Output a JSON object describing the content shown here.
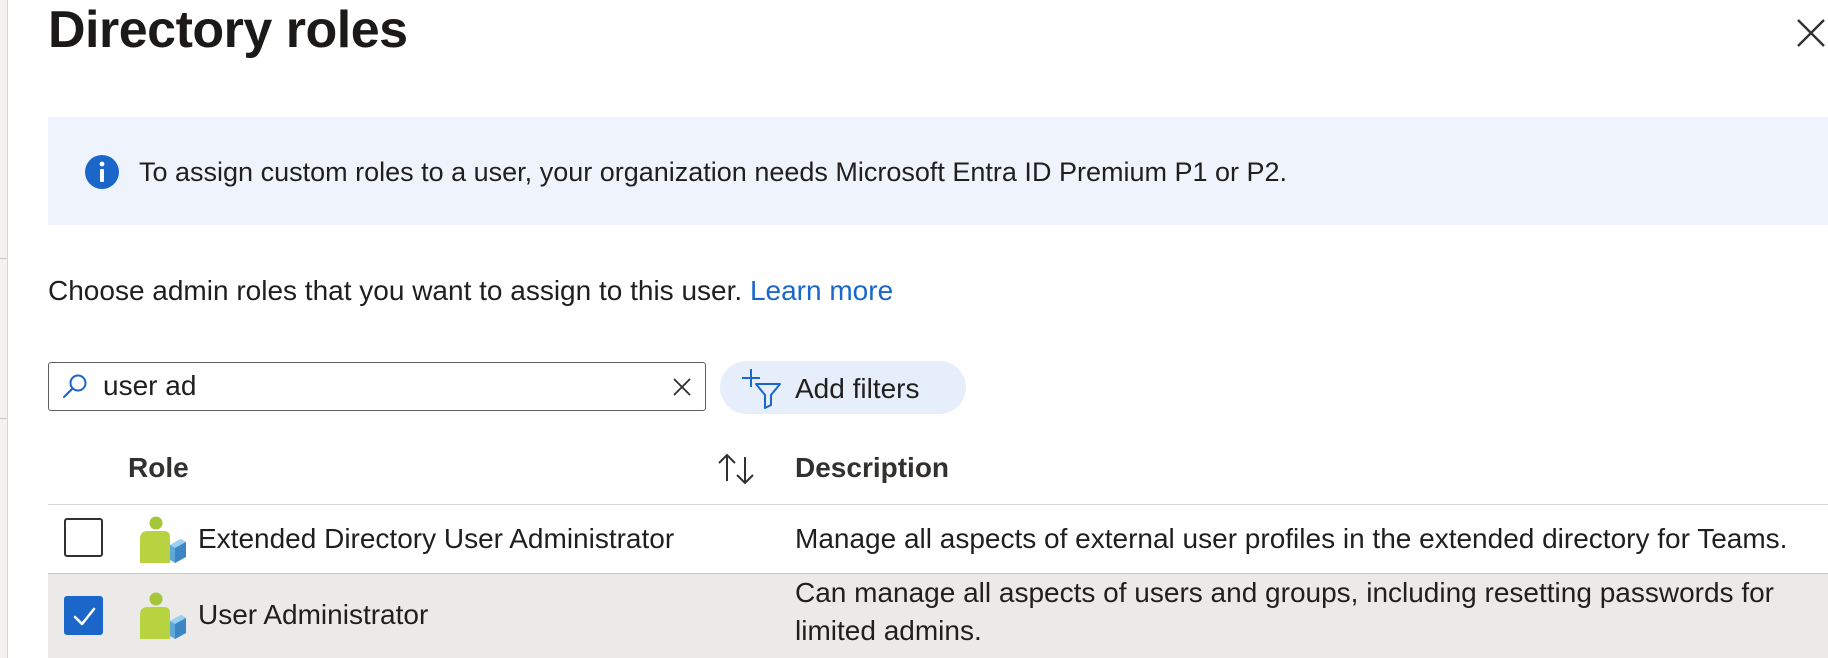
{
  "panel": {
    "title": "Directory roles",
    "close_icon": "close-icon"
  },
  "info_banner": {
    "icon": "info-icon",
    "text": "To assign custom roles to a user, your organization needs Microsoft Entra ID Premium P1 or P2.",
    "icon_color": "#1a66c9",
    "background": "#eff4fc"
  },
  "intro": {
    "text": "Choose admin roles that you want to assign to this user.",
    "link_label": "Learn more"
  },
  "search": {
    "value": "user ad",
    "icon": "search-icon",
    "clear_icon": "close-icon"
  },
  "filter_button": {
    "label": "Add filters",
    "icon": "add-filter-icon"
  },
  "table": {
    "columns": {
      "role": "Role",
      "description": "Description",
      "sort_icon": "sort-arrows-icon"
    },
    "rows": [
      {
        "checked": false,
        "icon": "role-user-icon",
        "name": "Extended Directory User Administrator",
        "description": "Manage all aspects of external user profiles in the extended directory for Teams."
      },
      {
        "checked": true,
        "icon": "role-user-icon",
        "name": "User Administrator",
        "description": "Can manage all aspects of users and groups, including resetting passwords for limited admins."
      }
    ]
  },
  "colors": {
    "accent": "#1a66c9",
    "selected_row": "#ebeae8",
    "filter_button_bg": "#e6eefb"
  }
}
